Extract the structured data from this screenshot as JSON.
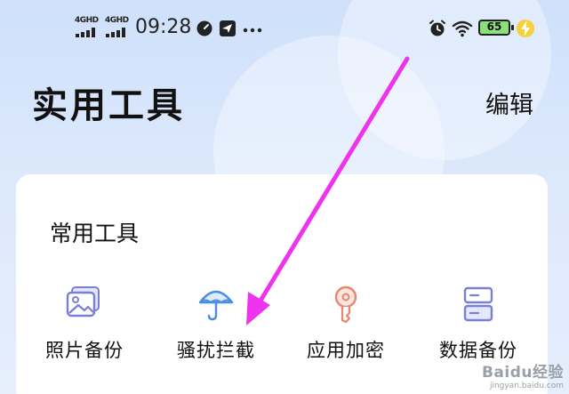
{
  "status_bar": {
    "signal_1": "4GHD",
    "signal_2": "4GHD",
    "time": "09:28",
    "battery": "65",
    "icons": [
      "signal-icon",
      "signal-icon",
      "speed-icon",
      "send-icon",
      "more-icon",
      "alarm-icon",
      "wifi-icon",
      "battery-icon",
      "charging-icon"
    ]
  },
  "header": {
    "title": "实用工具",
    "edit_label": "编辑"
  },
  "common_tools": {
    "title": "常用工具",
    "items": [
      {
        "label": "照片备份",
        "icon": "photo-backup-icon"
      },
      {
        "label": "骚扰拦截",
        "icon": "umbrella-icon"
      },
      {
        "label": "应用加密",
        "icon": "key-icon"
      },
      {
        "label": "数据备份",
        "icon": "server-icon"
      }
    ]
  },
  "colors": {
    "accent": "#7a7fd6",
    "umbrella": "#4a8fe0",
    "key": "#e8866a",
    "annotation_arrow": "#ee33ee"
  },
  "watermark": {
    "main": "Baidu经验",
    "sub": "jingyan.baidu.com"
  }
}
